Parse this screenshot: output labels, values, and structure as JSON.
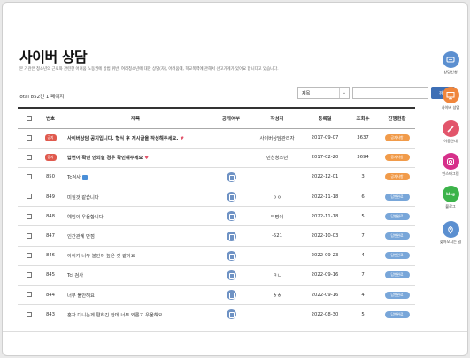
{
  "page": {
    "title": "사이버 상담",
    "subtitle": "본 기관은 청소년의 근로와 관련한 어려움 노동권에 방법 위반, 여러청소년에 대한 상담(자), 어려움에, 학교폭력에 관해서 선고가게가 있어요 합니다고 있습니다."
  },
  "list": {
    "total": "Total 852건 1 페이지"
  },
  "search": {
    "field": "제목",
    "chevron": "⌄",
    "button": "검색"
  },
  "table": {
    "headers": [
      "번호",
      "제목",
      "공개여부",
      "작성자",
      "등록일",
      "조회수",
      "진행현황"
    ],
    "rows": [
      {
        "num": "공지",
        "title": "사이버상담 공지입니다. 형식 후 게시글을 작성해주세요.",
        "public": "",
        "author": "사이버상담관리자",
        "date": "2017-09-07",
        "views": "3637",
        "status": "공지사항",
        "notice": true
      },
      {
        "num": "공지",
        "title": "답변이 확인 안되실 경우 확인해주세요",
        "public": "",
        "author": "민천청소년",
        "date": "2017-02-20",
        "views": "3694",
        "status": "공지사항",
        "notice": true
      },
      {
        "num": "850",
        "title": "Tc검사",
        "public": "lock",
        "author": "",
        "date": "2022-12-01",
        "views": "3",
        "status": "공지사항",
        "notice": false
      },
      {
        "num": "849",
        "title": "미칠것 같습니다",
        "public": "lock",
        "author": "ㅇㅇ",
        "date": "2022-11-18",
        "views": "6",
        "status": "답변완료",
        "notice": false
      },
      {
        "num": "848",
        "title": "예임이 우울합니다",
        "public": "lock",
        "author": "익명이",
        "date": "2022-11-18",
        "views": "5",
        "status": "답변완료",
        "notice": false
      },
      {
        "num": "847",
        "title": "인간관계 만점",
        "public": "lock",
        "author": "-521",
        "date": "2022-10-03",
        "views": "7",
        "status": "답변완료",
        "notice": false
      },
      {
        "num": "846",
        "title": "아이가 너무 불안이 높은 것 같아요",
        "public": "lock",
        "author": "",
        "date": "2022-09-23",
        "views": "4",
        "status": "답변완료",
        "notice": false
      },
      {
        "num": "845",
        "title": "Tci 검사",
        "public": "lock",
        "author": "ㅋㄴ",
        "date": "2022-09-16",
        "views": "7",
        "status": "답변완료",
        "notice": false
      },
      {
        "num": "844",
        "title": "너무 불안해요",
        "public": "lock",
        "author": "ㅎㅎ",
        "date": "2022-09-16",
        "views": "4",
        "status": "답변완료",
        "notice": false
      },
      {
        "num": "843",
        "title": "혼자 다니는게 편하긴 한데 너무 외롭고 우울해요",
        "public": "lock",
        "author": "",
        "date": "2022-08-30",
        "views": "5",
        "status": "답변완료",
        "notice": false
      }
    ]
  },
  "sidebar": {
    "items": [
      {
        "label": "상담신청",
        "icon": "chat-icon",
        "color": "#5b8fd0"
      },
      {
        "label": "사이버 상담",
        "icon": "monitor-icon",
        "color": "#f0863c"
      },
      {
        "label": "이용안내",
        "icon": "pencil-icon",
        "color": "#e2556b"
      },
      {
        "label": "인스타그램",
        "icon": "instagram-icon",
        "color": "#d6308a"
      },
      {
        "label": "블로그",
        "icon": "blog-icon",
        "color": "#3cb34a"
      },
      {
        "label": "찾아오시는 길",
        "icon": "location-icon",
        "color": "#5b8fd0"
      }
    ],
    "blog_text": "blog"
  },
  "colors": {
    "accent": "#3e6fb5",
    "notice": "#e05a4e",
    "status_orange": "#f19b4a",
    "status_blue": "#78a6d9"
  }
}
